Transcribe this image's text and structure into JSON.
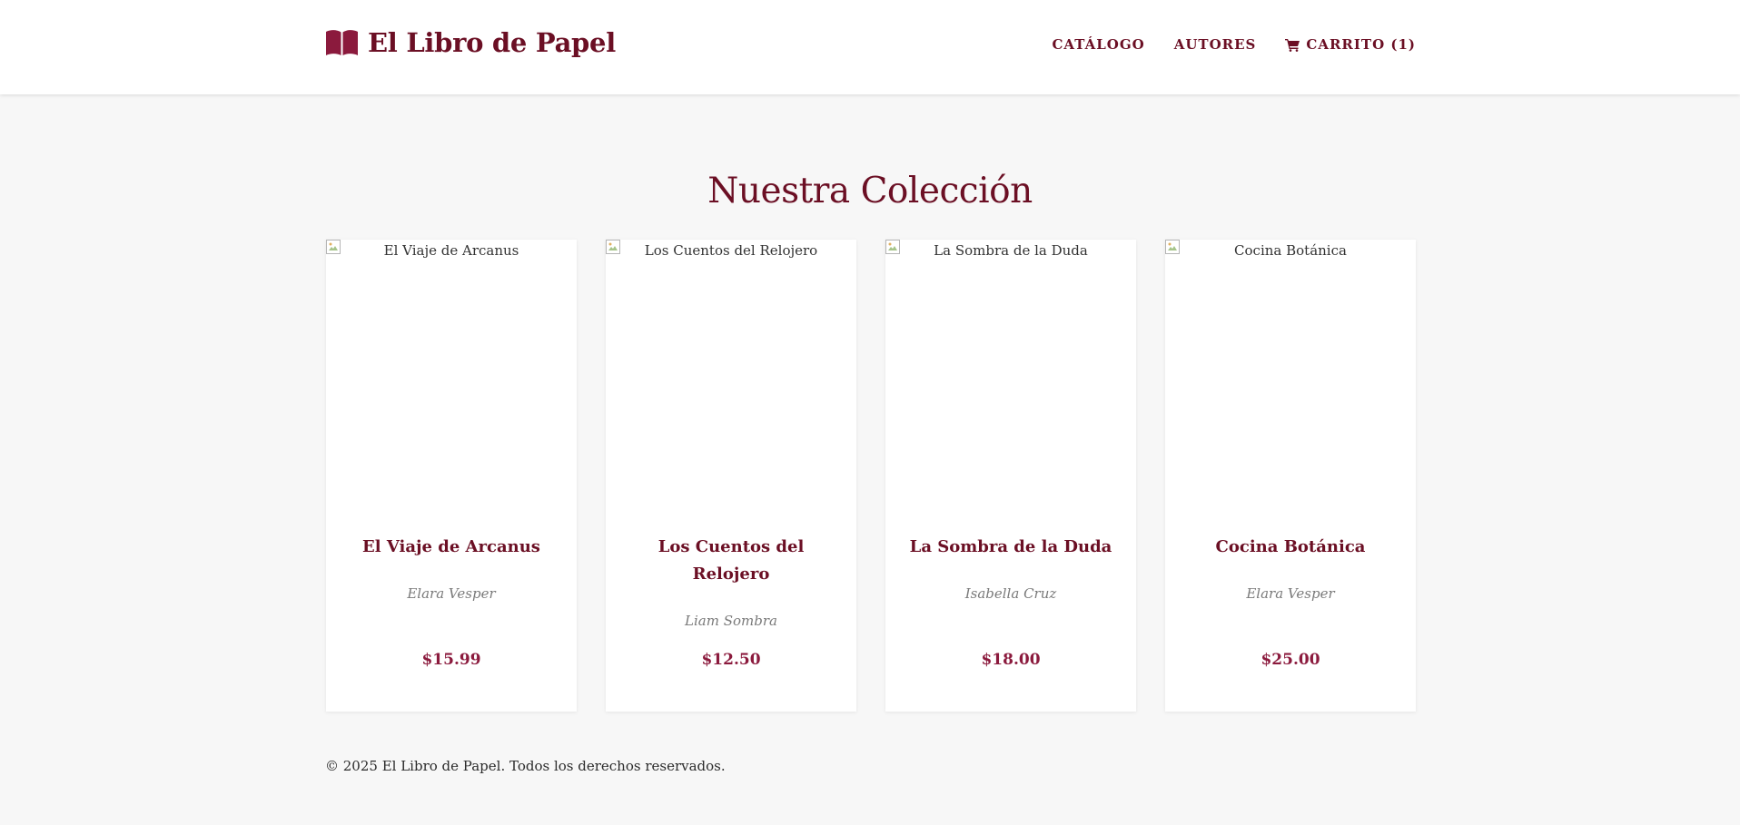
{
  "header": {
    "brand_name": "El Libro de Papel",
    "brand_icon": "open-book-icon",
    "nav": [
      {
        "label": "CATÁLOGO"
      },
      {
        "label": "AUTORES"
      },
      {
        "label": "CARRITO (1)",
        "icon": "cart-icon"
      }
    ]
  },
  "main": {
    "title": "Nuestra Colección",
    "books": [
      {
        "cover_alt": "El Viaje de Arcanus",
        "title": "El Viaje de Arcanus",
        "author": "Elara Vesper",
        "price": "$15.99"
      },
      {
        "cover_alt": "Los Cuentos del Relojero",
        "title": "Los Cuentos del Relojero",
        "author": "Liam Sombra",
        "price": "$12.50"
      },
      {
        "cover_alt": "La Sombra de la Duda",
        "title": "La Sombra de la Duda",
        "author": "Isabella Cruz",
        "price": "$18.00"
      },
      {
        "cover_alt": "Cocina Botánica",
        "title": "Cocina Botánica",
        "author": "Elara Vesper",
        "price": "$25.00"
      }
    ]
  },
  "footer": {
    "text": "© 2025 El Libro de Papel. Todos los derechos reservados."
  },
  "colors": {
    "brand": "#6b0f24",
    "price": "#8b1a3d",
    "author": "#7a7a7a",
    "background": "#f7f7f7",
    "card": "#ffffff"
  }
}
